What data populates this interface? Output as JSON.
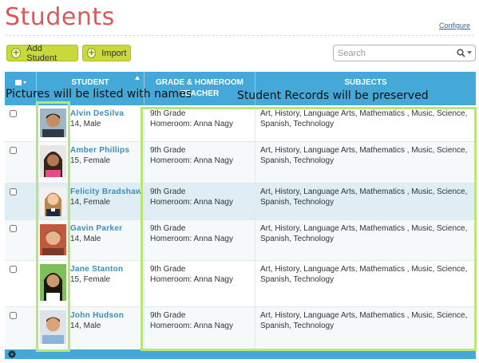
{
  "header": {
    "title": "Students",
    "configure_label": "Configure"
  },
  "toolbar": {
    "add_label": "Add Student",
    "import_label": "Import",
    "search_placeholder": "Search",
    "search_icon": "search-icon",
    "plus_icon": "plus-circle-icon"
  },
  "table": {
    "columns": [
      "STUDENT",
      "GRADE & HOMEROOM TEACHER",
      "SUBJECTS"
    ],
    "sort_column": "STUDENT",
    "sort_direction": "ascending",
    "rows": [
      {
        "name": "Alvin DeSilva",
        "details": "14, Male",
        "grade": "9th Grade",
        "homeroom": "Homeroom: Anna Nagy",
        "subjects": "Art, History, Language Arts, Mathematics , Music, Science, Spanish, Technology",
        "checked": false
      },
      {
        "name": "Amber Phillips",
        "details": "15, Female",
        "grade": "9th Grade",
        "homeroom": "Homeroom: Anna Nagy",
        "subjects": "Art, History, Language Arts, Mathematics , Music, Science, Spanish, Technology",
        "checked": false
      },
      {
        "name": "Felicity Bradshaw",
        "details": "14, Female",
        "grade": "9th Grade",
        "homeroom": "Homeroom: Anna Nagy",
        "subjects": "Art, History, Language Arts, Mathematics , Music, Science, Spanish, Technology",
        "checked": false,
        "highlighted": true
      },
      {
        "name": "Gavin Parker",
        "details": "14, Male",
        "grade": "9th Grade",
        "homeroom": "Homeroom: Anna Nagy",
        "subjects": "Art, History, Language Arts, Mathematics , Music, Science, Spanish, Technology",
        "checked": false
      },
      {
        "name": "Jane Stanton",
        "details": "15, Female",
        "grade": "9th Grade",
        "homeroom": "Homeroom: Anna Nagy",
        "subjects": "Art, History, Language Arts, Mathematics , Music, Science, Spanish, Technology",
        "checked": false
      },
      {
        "name": "John Hudson",
        "details": "14, Male",
        "grade": "9th Grade",
        "homeroom": "Homeroom: Anna Nagy",
        "subjects": "Art, History, Language Arts, Mathematics , Music, Science, Spanish, Technology",
        "checked": false
      }
    ]
  },
  "annotations": {
    "left": "Pictures will be listed with names",
    "right": "Student Records will be preserved"
  },
  "colors": {
    "title": "#d65a5e",
    "header_blue": "#44a8d8",
    "button_green": "#c9d93a",
    "link_blue": "#3c8dbf",
    "callout_green": "#b9e67a",
    "row_highlight": "#dfeef5"
  },
  "footer": {
    "settings_icon": "gear-icon"
  }
}
